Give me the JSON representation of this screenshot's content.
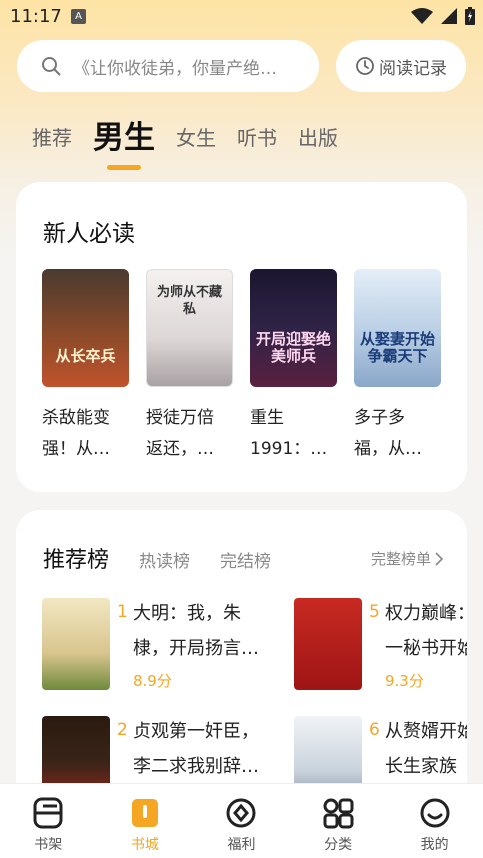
{
  "status_bar": {
    "time": "11:17",
    "notif_icon": "A"
  },
  "search": {
    "placeholder": "《让你收徒弟，你量产绝世大帝》",
    "history_label": "阅读记录"
  },
  "tabs": [
    {
      "label": "推荐"
    },
    {
      "label": "男生",
      "active": true
    },
    {
      "label": "女生"
    },
    {
      "label": "听书"
    },
    {
      "label": "出版"
    }
  ],
  "new_reader": {
    "title": "新人必读",
    "books": [
      {
        "line1": "杀敌能变",
        "line2": "强！从…",
        "cover_text": "从长卒兵",
        "cover_color": "#6b3b2a"
      },
      {
        "line1": "授徒万倍",
        "line2": "返还，…",
        "cover_text": "为师从不藏私",
        "cover_color": "#e9e6e6"
      },
      {
        "line1": "重生",
        "line2": "1991：…",
        "cover_text": "开局迎娶绝美师兵",
        "cover_color": "#2a1d3a"
      },
      {
        "line1": "多子多",
        "line2": "福，从…",
        "cover_text": "从娶妻开始争霸天下",
        "cover_color": "#c7d8ec"
      }
    ]
  },
  "ranking": {
    "tab_active": "推荐榜",
    "tab_hot": "热读榜",
    "tab_done": "完结榜",
    "full_list": "完整榜单",
    "items": [
      {
        "num": "1",
        "line1": "大明：我，朱",
        "line2": "棣，开局扬言…",
        "score": "8.9分",
        "cover_color": "#e8d9a8"
      },
      {
        "num": "5",
        "line1": "权力巅峰：",
        "line2": "一秘书开始",
        "score": "9.3分",
        "cover_color": "#b51e1e"
      },
      {
        "num": "2",
        "line1": "贞观第一奸臣，",
        "line2": "李二求我别辞…",
        "score": "",
        "cover_color": "#2b1b12"
      },
      {
        "num": "6",
        "line1": "从赘婿开始",
        "line2": "长生家族",
        "score": "",
        "cover_color": "#dfe4ea"
      }
    ]
  },
  "nav": [
    {
      "label": "书架",
      "icon": "bookshelf-icon"
    },
    {
      "label": "书城",
      "icon": "bookstore-icon",
      "active": true
    },
    {
      "label": "福利",
      "icon": "welfare-icon"
    },
    {
      "label": "分类",
      "icon": "category-icon"
    },
    {
      "label": "我的",
      "icon": "profile-icon"
    }
  ],
  "colors": {
    "accent": "#f5a623",
    "header_bg": "#fde3a4"
  }
}
